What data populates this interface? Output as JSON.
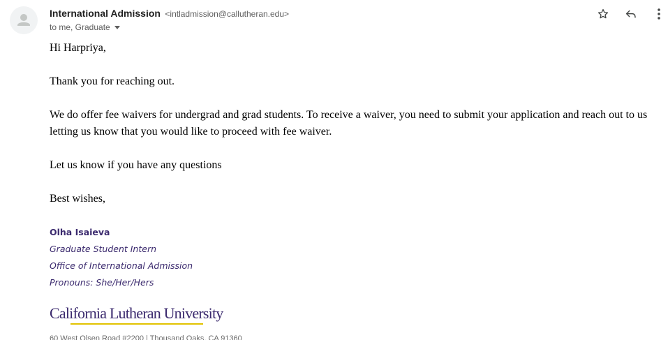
{
  "sender": {
    "name": "International Admission",
    "email": "<intladmission@callutheran.edu>"
  },
  "recipients": "to me, Graduate",
  "actions": {
    "star_icon": "star-icon",
    "reply_icon": "reply-icon",
    "more_icon": "more-vert-icon"
  },
  "message": {
    "greeting": "Hi Harpriya,",
    "paragraphs": [
      "Thank you for reaching out.",
      "We do offer fee waivers for undergrad and grad students. To receive a waiver, you need to submit your application and reach out to us letting us know that you would like to proceed with fee waiver.",
      "Let us know if you have any questions"
    ],
    "closing": "Best wishes,"
  },
  "signature": {
    "name": "Olha Isaieva",
    "title": "Graduate Student Intern",
    "office": "Office of International Admission",
    "pronouns": "Pronouns: She/Her/Hers"
  },
  "logo_text": "California Lutheran University",
  "address": "60 West Olsen Road #2200 | Thousand Oaks, CA 91360",
  "colors": {
    "signature": "#3b2a6e",
    "logo_rule": "#e1c300"
  }
}
